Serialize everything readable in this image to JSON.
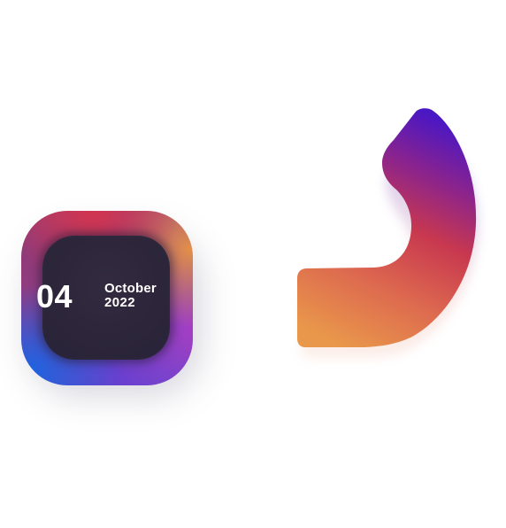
{
  "date_widget": {
    "day": "04",
    "month": "October",
    "year": "2022"
  },
  "colors": {
    "background": "#ffffff",
    "widget_inner": "#2b2539",
    "widget_blue": "#1f63e0",
    "widget_red": "#d2344f",
    "widget_orange": "#e28f4a",
    "widget_purple": "#a53ec4",
    "curve_top": "#4a17c4",
    "curve_middle": "#c8384f",
    "curve_bottom": "#e9974b"
  },
  "icons": [
    "curved-arrow-shape"
  ]
}
